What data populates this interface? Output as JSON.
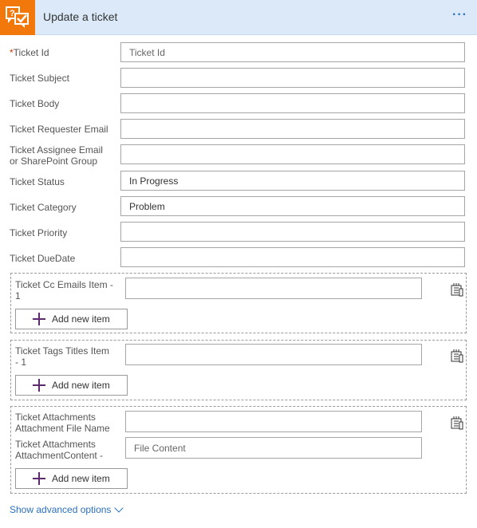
{
  "header": {
    "title": "Update a ticket",
    "more": "···"
  },
  "fields": {
    "ticket_id": {
      "label": "Ticket Id",
      "required": "*",
      "value": "",
      "placeholder": "Ticket Id"
    },
    "subject": {
      "label": "Ticket Subject",
      "value": ""
    },
    "body": {
      "label": "Ticket Body",
      "value": ""
    },
    "requester": {
      "label": "Ticket Requester Email",
      "value": ""
    },
    "assignee": {
      "label_line1": "Ticket Assignee Email",
      "label_line2": "or SharePoint Group",
      "value": ""
    },
    "status": {
      "label": "Ticket Status",
      "value": "In Progress"
    },
    "category": {
      "label": "Ticket Category",
      "value": "Problem"
    },
    "priority": {
      "label": "Ticket Priority",
      "value": ""
    },
    "duedate": {
      "label": "Ticket DueDate",
      "value": ""
    }
  },
  "groups": {
    "cc": {
      "label_line1": "Ticket Cc Emails Item -",
      "label_line2": "1",
      "value": "",
      "add_label": "Add new item"
    },
    "tags": {
      "label_line1": "Ticket Tags Titles Item",
      "label_line2": "- 1",
      "value": "",
      "add_label": "Add new item"
    },
    "attach": {
      "name_label_line1": "Ticket Attachments",
      "name_label_line2": "Attachment File Name",
      "name_value": "",
      "content_label_line1": "Ticket Attachments",
      "content_label_line2": "AttachmentContent -",
      "content_value": "",
      "content_placeholder": "File Content",
      "add_label": "Add new item"
    }
  },
  "advanced": {
    "label": "Show advanced options"
  }
}
